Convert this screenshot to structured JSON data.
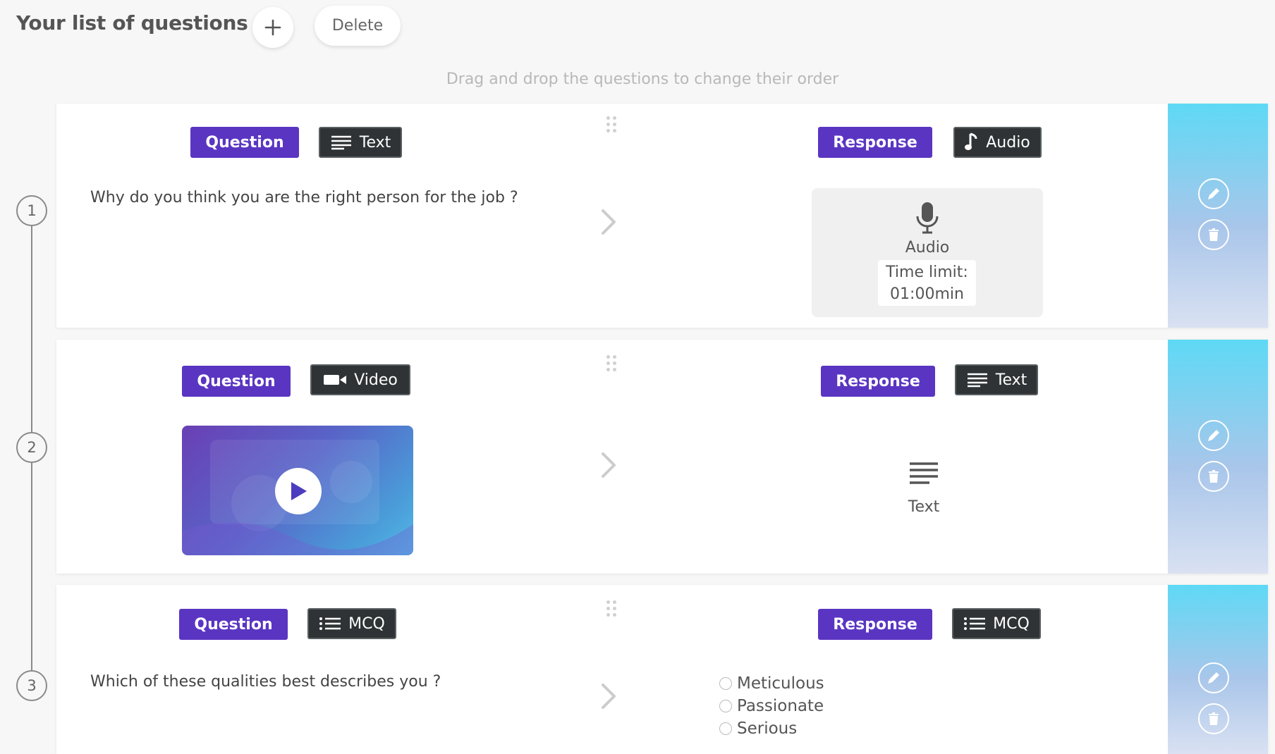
{
  "header": {
    "title": "Your list of questions",
    "delete_label": "Delete"
  },
  "hint": "Drag and drop the questions to change their order",
  "questions": [
    {
      "number": "1",
      "question_label": "Question",
      "question_type": "Text",
      "response_label": "Response",
      "response_type": "Audio",
      "text": "Why do you think you are the right person for the job ?",
      "audio": {
        "label": "Audio",
        "time_limit_label": "Time limit:",
        "time_limit_value": "01:00min"
      }
    },
    {
      "number": "2",
      "question_label": "Question",
      "question_type": "Video",
      "response_label": "Response",
      "response_type": "Text",
      "text_response_label": "Text"
    },
    {
      "number": "3",
      "question_label": "Question",
      "question_type": "MCQ",
      "response_label": "Response",
      "response_type": "MCQ",
      "text": "Which of these qualities best describes you ?",
      "options": [
        "Meticulous",
        "Passionate",
        "Serious"
      ]
    }
  ],
  "colors": {
    "purple_badge": "#5a35c2",
    "dark_badge": "#2f3335",
    "side_panel_top": "#5ed9f5",
    "side_panel_bottom": "#d9e1f2"
  }
}
